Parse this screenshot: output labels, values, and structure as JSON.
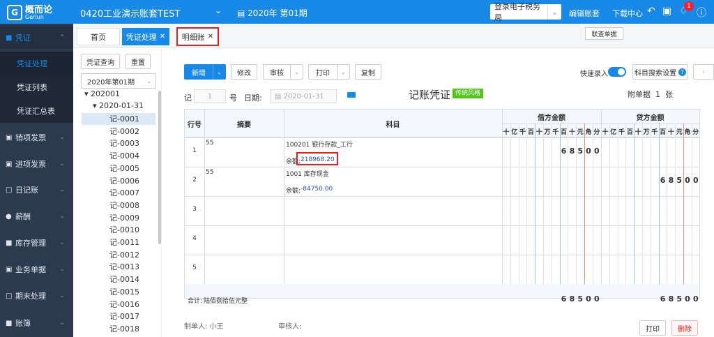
{
  "header": {
    "logo_zh": "概而论",
    "logo_en": "Gerlun",
    "account": "0420工业演示账套TEST",
    "period": "2020年 第01期",
    "tax_btn": "登录电子税务局",
    "edit_acct": "编辑账套",
    "download": "下载中心",
    "notify_count": "1"
  },
  "sidebar": {
    "items": [
      {
        "label": "凭证",
        "icon": "voucher-icon"
      },
      {
        "label": "销项发票",
        "icon": "sales-invoice-icon"
      },
      {
        "label": "进项发票",
        "icon": "purchase-invoice-icon"
      },
      {
        "label": "日记账",
        "icon": "journal-icon"
      },
      {
        "label": "薪酬",
        "icon": "salary-icon"
      },
      {
        "label": "库存管理",
        "icon": "inventory-icon"
      },
      {
        "label": "业务单据",
        "icon": "document-icon"
      },
      {
        "label": "期末处理",
        "icon": "period-end-icon"
      },
      {
        "label": "账簿",
        "icon": "ledger-icon"
      }
    ],
    "subitems": [
      "凭证处理",
      "凭证列表",
      "凭证汇总表"
    ]
  },
  "tabs": [
    {
      "label": "首页"
    },
    {
      "label": "凭证处理"
    },
    {
      "label": "明细账"
    }
  ],
  "link_btn": "联查单据",
  "left": {
    "query_btn": "凭证查询",
    "reset_btn": "重置",
    "period_select": "2020年第01期",
    "tree_root": "202001",
    "tree_date": "2020-01-31",
    "vouchers": [
      "记-0001",
      "记-0002",
      "记-0003",
      "记-0004",
      "记-0005",
      "记-0006",
      "记-0007",
      "记-0008",
      "记-0009",
      "记-0010",
      "记-0011",
      "记-0012",
      "记-0013",
      "记-0014",
      "记-0015",
      "记-0016",
      "记-0017",
      "记-0018"
    ]
  },
  "toolbar": {
    "new": "新增",
    "modify": "修改",
    "audit": "审核",
    "print": "打印",
    "copy": "复制",
    "quick_entry": "快速录入",
    "search_settings": "科目搜索设置"
  },
  "voucher": {
    "word": "记",
    "number": "1",
    "no_label": "号",
    "date_label": "日期:",
    "date": "2020-01-31",
    "title": "记账凭证",
    "style_badge": "传统风格",
    "attach_label": "附单据",
    "attach_count": "1",
    "attach_unit": "张"
  },
  "table": {
    "headers": {
      "row": "行号",
      "summary": "摘要",
      "account": "科目",
      "debit": "借方金额",
      "credit": "贷方金额"
    },
    "units": [
      "十",
      "亿",
      "千",
      "百",
      "十",
      "万",
      "千",
      "百",
      "十",
      "元",
      "角",
      "分"
    ],
    "rows": [
      {
        "no": "1",
        "summary": "55",
        "account": "100201 银行存款_工行",
        "balance_label": "余额:",
        "balance": "218968.20",
        "debit": "68500",
        "credit": ""
      },
      {
        "no": "2",
        "summary": "55",
        "account": "1001 库存现金",
        "balance_label": "余额:",
        "balance": "-84750.00",
        "debit": "",
        "credit": "68500"
      },
      {
        "no": "3"
      },
      {
        "no": "4"
      },
      {
        "no": "5"
      }
    ],
    "total_label": "合计:",
    "total_text": "陆佰捌拾伍元整",
    "total_debit": "68500",
    "total_credit": "68500"
  },
  "footer": {
    "maker": "制单人: 小王",
    "auditor": "审核人:",
    "print": "打印",
    "delete": "删除"
  }
}
